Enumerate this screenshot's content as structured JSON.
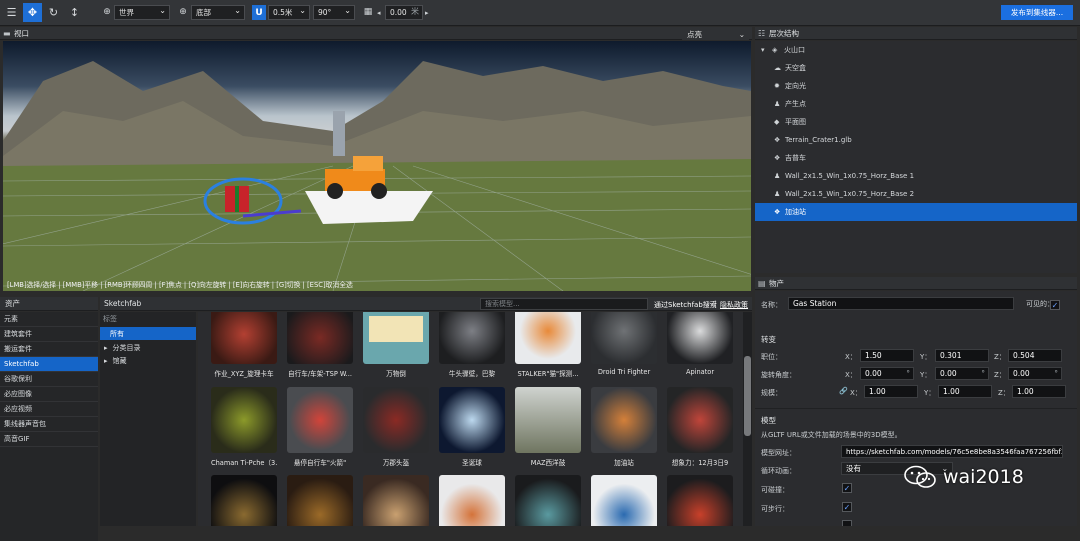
{
  "toolbar": {
    "space_select": "世界",
    "pivot_select": "底部",
    "snap_distance": "0.5米",
    "snap_angle": "90°",
    "grid_value": "0.00",
    "grid_unit": "米",
    "publish_label": "发布到集线器..."
  },
  "viewport": {
    "title": "视口",
    "mode": "点亮",
    "help": "[LMB]选择/选择 | [MMB]平移 | [RMB]环顾四周 | [F]焦点 | [Q]向左旋转 | [E]向右旋转 | [G]切换 | [ESC]取消全选"
  },
  "hierarchy": {
    "title": "层次结构",
    "items": [
      {
        "label": "火山口",
        "icon": "scene-icon"
      },
      {
        "label": "天空盒",
        "icon": "cloud-icon"
      },
      {
        "label": "定向光",
        "icon": "sun-icon"
      },
      {
        "label": "产生点",
        "icon": "spawn-icon"
      },
      {
        "label": "平面图",
        "icon": "plane-icon"
      },
      {
        "label": "Terrain_Crater1.glb",
        "icon": "model-icon"
      },
      {
        "label": "吉普车",
        "icon": "model-icon"
      },
      {
        "label": "Wall_2x1.5_Win_1x0.75_Horz_Base 1",
        "icon": "spawn-icon"
      },
      {
        "label": "Wall_2x1.5_Win_1x0.75_Horz_Base 2",
        "icon": "spawn-icon"
      },
      {
        "label": "加油站",
        "icon": "model-icon"
      }
    ]
  },
  "inspector": {
    "title": "物产",
    "name_label": "名称：",
    "name_value": "Gas Station",
    "visible_label": "可见的：",
    "transform_title": "转变",
    "position_label": "职位：",
    "rotation_label": "旋转角度：",
    "scale_label": "规模：",
    "axis_x": "X：",
    "axis_y": "Y：",
    "axis_z": "Z：",
    "deg": "°",
    "position": [
      "1.50",
      "0.301",
      "0.504"
    ],
    "rotation": [
      "0.00",
      "0.00",
      "0.00"
    ],
    "scale": [
      "1.00",
      "1.00",
      "1.00"
    ],
    "model_title": "模型",
    "model_desc": "从GLTF URL或文件加载的场景中的3D模型。",
    "model_url_label": "模型网址：",
    "model_url_value": "https://sketchfab.com/models/76c5e8be8a3546faa767256fbf3c2",
    "loop_label": "循环动画：",
    "loop_value": "没有",
    "collidable_label": "可碰撞：",
    "walkable_label": "可步行："
  },
  "assets": {
    "title": "资产",
    "items": [
      "元素",
      "建筑套件",
      "搬运套件",
      "Sketchfab",
      "谷歌保利",
      "必应图像",
      "必应视频",
      "集线器声音包",
      "高音GIF"
    ],
    "active": "Sketchfab",
    "source_title": "Sketchfab",
    "search_placeholder": "搜索模型...",
    "search_via": "通过Sketchfab搜索",
    "separator": "|",
    "privacy": "隐私政策"
  },
  "categories": {
    "title": "标签",
    "items": [
      {
        "label": "所有",
        "active": true
      },
      {
        "label": "分类目录",
        "arrow": "▸"
      },
      {
        "label": "馆藏",
        "arrow": "▸"
      }
    ]
  },
  "models": [
    {
      "label": "作业_XYZ_旋理卡车"
    },
    {
      "label": "自行车/车架-TSP W..."
    },
    {
      "label": "万物倒"
    },
    {
      "label": "牛头骤壁，巴黎"
    },
    {
      "label": "STALKER\"猫\"探测..."
    },
    {
      "label": "Droid Tri Fighter"
    },
    {
      "label": "Apinator"
    },
    {
      "label": "Chaman Ti-Pche（3..."
    },
    {
      "label": "悬停自行车\"火箭\""
    },
    {
      "label": "万郡头盔"
    },
    {
      "label": "圣诞球"
    },
    {
      "label": "MAZ西洋鼓"
    },
    {
      "label": "加油站"
    },
    {
      "label": "想象力：12月3日9"
    },
    {
      "label": ""
    },
    {
      "label": ""
    },
    {
      "label": ""
    },
    {
      "label": ""
    },
    {
      "label": ""
    },
    {
      "label": ""
    },
    {
      "label": ""
    }
  ],
  "watermark": "wai2018"
}
